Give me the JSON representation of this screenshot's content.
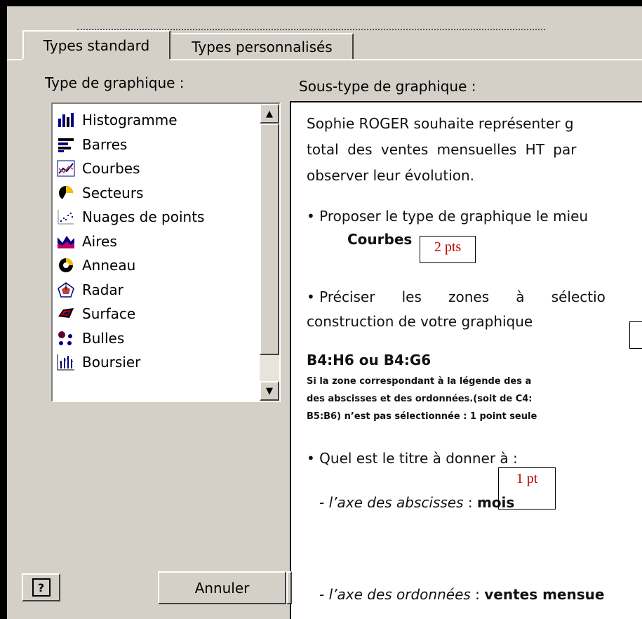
{
  "tabs": [
    {
      "label": "Types standard"
    },
    {
      "label": "Types personnalisés"
    }
  ],
  "left_label": "Type de graphique :",
  "right_label": "Sous-type de graphique :",
  "chart_types": [
    {
      "label": "Histogramme",
      "icon": "histogram-icon"
    },
    {
      "label": "Barres",
      "icon": "bar-chart-icon"
    },
    {
      "label": "Courbes",
      "icon": "line-chart-icon"
    },
    {
      "label": "Secteurs",
      "icon": "pie-chart-icon"
    },
    {
      "label": "Nuages de points",
      "icon": "scatter-chart-icon"
    },
    {
      "label": "Aires",
      "icon": "area-chart-icon"
    },
    {
      "label": "Anneau",
      "icon": "doughnut-chart-icon"
    },
    {
      "label": "Radar",
      "icon": "radar-chart-icon"
    },
    {
      "label": "Surface",
      "icon": "surface-chart-icon"
    },
    {
      "label": "Bulles",
      "icon": "bubble-chart-icon"
    },
    {
      "label": "Boursier",
      "icon": "stock-chart-icon"
    }
  ],
  "doc": {
    "line1": "Sophie ROGER souhaite représenter g",
    "line2": "total des ventes mensuelles HT par",
    "line3": "observer leur évolution.",
    "bullet1": "• Proposer le type de graphique le mieu",
    "answer1": "Courbes",
    "pts1": "2 pts",
    "bullet2": "• Préciser      les      zones      à      sélectio",
    "bullet2b": "construction de votre graphique",
    "answer2": "B4:H6 ou B4:G6",
    "note1": "Si la zone correspondant à la légende des a",
    "note2": "des abscisses et des ordonnées.(soit de C4:",
    "note3": "B5:B6) n’est pas sélectionnée : 1 point seule",
    "bullet3": "• Quel est le titre à donner à :",
    "axis1_label": "- l’axe des abscisses",
    "axis1_sep": " : ",
    "axis1_value": "mois",
    "pts2": "1 pt",
    "axis2_label": "- l’axe des ordonnées",
    "axis2_sep": " : ",
    "axis2_value": "ventes mensue"
  },
  "buttons": {
    "help": "?",
    "cancel": "Annuler"
  }
}
